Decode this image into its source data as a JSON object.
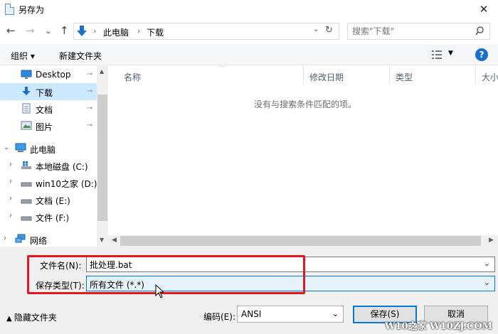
{
  "window": {
    "title": "另存为",
    "close_glyph": "✕"
  },
  "nav": {
    "back": "←",
    "forward": "→",
    "history": "⌄",
    "up": "↑",
    "breadcrumb": [
      "此电脑",
      "下载"
    ],
    "separator": "›",
    "refresh": "↻"
  },
  "search": {
    "placeholder": "搜索\"下载\""
  },
  "toolbar": {
    "organize": "组织 ▾",
    "new_folder": "新建文件夹",
    "view_dropdown": "▼",
    "help": "?"
  },
  "sidebar": {
    "items": [
      {
        "label": "Desktop",
        "pinned": true,
        "icon": "desktop-icon"
      },
      {
        "label": "下载",
        "pinned": true,
        "selected": true,
        "icon": "download-icon"
      },
      {
        "label": "文档",
        "pinned": true,
        "icon": "document-icon"
      },
      {
        "label": "图片",
        "pinned": true,
        "icon": "picture-icon"
      },
      {
        "label": "此电脑",
        "expanded": true,
        "icon": "computer-icon"
      },
      {
        "label": "本地磁盘 (C:)",
        "icon": "system-drive-icon"
      },
      {
        "label": "win10之家 (D:)",
        "icon": "drive-icon"
      },
      {
        "label": "文档 (E:)",
        "icon": "drive-icon"
      },
      {
        "label": "文件 (F:)",
        "icon": "drive-icon"
      },
      {
        "label": "网络",
        "icon": "network-icon"
      }
    ],
    "pin_glyph": "📌",
    "collapse_glyph": "⌄",
    "expand_glyph": "›"
  },
  "file_list": {
    "columns": [
      "名称",
      "修改日期",
      "类型",
      "大小"
    ],
    "empty_message": "没有与搜索条件匹配的项。"
  },
  "form": {
    "filename_label": "文件名(N):",
    "filename_value": "批处理.bat",
    "type_label": "保存类型(T):",
    "type_value": "所有文件  (*.*)"
  },
  "footer": {
    "hide_folders": "隐藏文件夹",
    "encoding_label": "编码(E):",
    "encoding_value": "ANSI",
    "save": "保存(S)",
    "cancel": "取消",
    "watermark": "W10之家 W10ZJ.COM"
  },
  "colors": {
    "selection": "#cce8ff",
    "highlight_border": "#e01820",
    "accent": "#0078d7"
  }
}
